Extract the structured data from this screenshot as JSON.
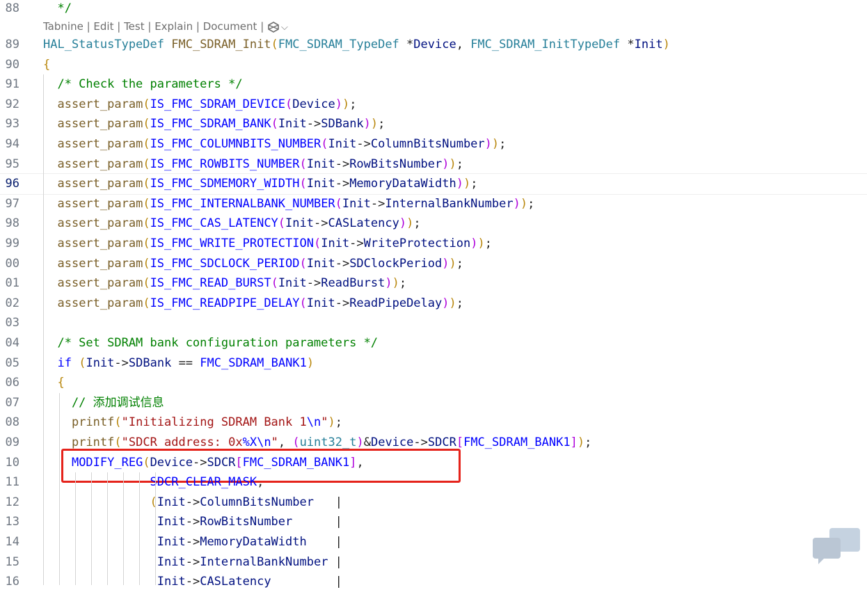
{
  "codelens": {
    "items": [
      "Tabnine",
      "Edit",
      "Test",
      "Explain",
      "Document"
    ],
    "separator": " | "
  },
  "lines": [
    {
      "num": "88",
      "text": "  */"
    },
    {
      "num": "89",
      "text": "HAL_StatusTypeDef FMC_SDRAM_Init(FMC_SDRAM_TypeDef *Device, FMC_SDRAM_InitTypeDef *Init)"
    },
    {
      "num": "90",
      "text": "{"
    },
    {
      "num": "91",
      "text": "  /* Check the parameters */"
    },
    {
      "num": "92",
      "text": "  assert_param(IS_FMC_SDRAM_DEVICE(Device));"
    },
    {
      "num": "93",
      "text": "  assert_param(IS_FMC_SDRAM_BANK(Init->SDBank));"
    },
    {
      "num": "94",
      "text": "  assert_param(IS_FMC_COLUMNBITS_NUMBER(Init->ColumnBitsNumber));"
    },
    {
      "num": "95",
      "text": "  assert_param(IS_FMC_ROWBITS_NUMBER(Init->RowBitsNumber));"
    },
    {
      "num": "96",
      "text": "  assert_param(IS_FMC_SDMEMORY_WIDTH(Init->MemoryDataWidth));"
    },
    {
      "num": "97",
      "text": "  assert_param(IS_FMC_INTERNALBANK_NUMBER(Init->InternalBankNumber));"
    },
    {
      "num": "98",
      "text": "  assert_param(IS_FMC_CAS_LATENCY(Init->CASLatency));"
    },
    {
      "num": "99",
      "text": "  assert_param(IS_FMC_WRITE_PROTECTION(Init->WriteProtection));"
    },
    {
      "num": "00",
      "text": "  assert_param(IS_FMC_SDCLOCK_PERIOD(Init->SDClockPeriod));"
    },
    {
      "num": "01",
      "text": "  assert_param(IS_FMC_READ_BURST(Init->ReadBurst));"
    },
    {
      "num": "02",
      "text": "  assert_param(IS_FMC_READPIPE_DELAY(Init->ReadPipeDelay));"
    },
    {
      "num": "03",
      "text": ""
    },
    {
      "num": "04",
      "text": "  /* Set SDRAM bank configuration parameters */"
    },
    {
      "num": "05",
      "text": "  if (Init->SDBank == FMC_SDRAM_BANK1)"
    },
    {
      "num": "06",
      "text": "  {"
    },
    {
      "num": "07",
      "text": "    // 添加调试信息"
    },
    {
      "num": "08",
      "text": "    printf(\"Initializing SDRAM Bank 1\\n\");"
    },
    {
      "num": "09",
      "text": "    printf(\"SDCR address: 0x%X\\n\", (uint32_t)&Device->SDCR[FMC_SDRAM_BANK1]);"
    },
    {
      "num": "10",
      "text": "    MODIFY_REG(Device->SDCR[FMC_SDRAM_BANK1],"
    },
    {
      "num": "11",
      "text": "               SDCR_CLEAR_MASK,"
    },
    {
      "num": "12",
      "text": "               (Init->ColumnBitsNumber   |"
    },
    {
      "num": "13",
      "text": "                Init->RowBitsNumber      |"
    },
    {
      "num": "14",
      "text": "                Init->MemoryDataWidth    |"
    },
    {
      "num": "15",
      "text": "                Init->InternalBankNumber |"
    },
    {
      "num": "16",
      "text": "                Init->CASLatency         |"
    }
  ],
  "current_line": "96",
  "colors": {
    "highlight_box": "#e5231b",
    "type": "#267f99",
    "function": "#795e26",
    "parameter": "#001080",
    "comment": "#008000",
    "keyword": "#0000ff",
    "string": "#a31515"
  },
  "icons": {
    "codelens_logo": "tabnine-logo-icon",
    "codelens_dropdown": "chevron-down-icon",
    "watermark": "chat-bubble-icon"
  }
}
